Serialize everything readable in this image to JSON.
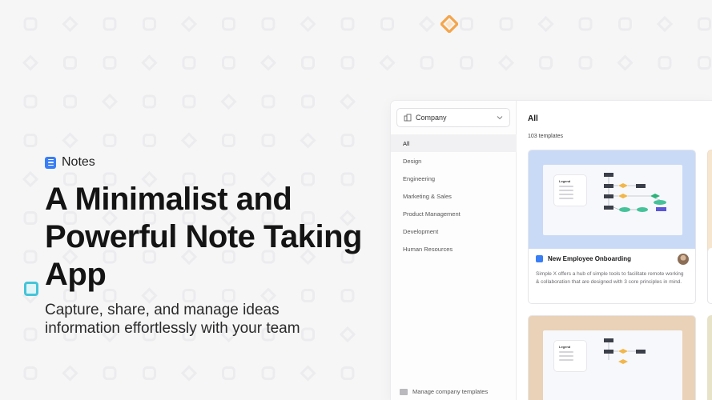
{
  "hero": {
    "app_name": "Notes",
    "title": "A Minimalist and Powerful Note Taking App",
    "subtitle": "Capture, share, and manage ideas information effortlessly with your team"
  },
  "sidebar": {
    "workspace_select": "Company",
    "categories": [
      "All",
      "Design",
      "Engineering",
      "Marketing & Sales",
      "Product Management",
      "Development",
      "Human Resources"
    ],
    "selected_category": "All",
    "manage_link": "Manage company templates"
  },
  "main": {
    "title": "All",
    "template_count": "103 templates",
    "cards": [
      {
        "title": "New Employee Onboarding",
        "description": "Simple X offers a hub of simple tools to facilitate remote working & collaboration that are designed with 3 core principles in mind.",
        "legend_title": "Legend"
      },
      {
        "title": "",
        "description": "",
        "legend_title": "Legend"
      }
    ]
  },
  "colors": {
    "accent_blue": "#3a7ef5",
    "brand_orange": "#f5a54a",
    "accent_teal": "#45c4d8",
    "card_blue": "#c9daf7",
    "card_tan": "#e9d2b7"
  },
  "icons": {
    "brand": "diamond-logo-icon",
    "app": "notes-icon",
    "workspace": "building-icon",
    "dropdown": "chevron-down-icon",
    "manage": "folder-icon"
  }
}
